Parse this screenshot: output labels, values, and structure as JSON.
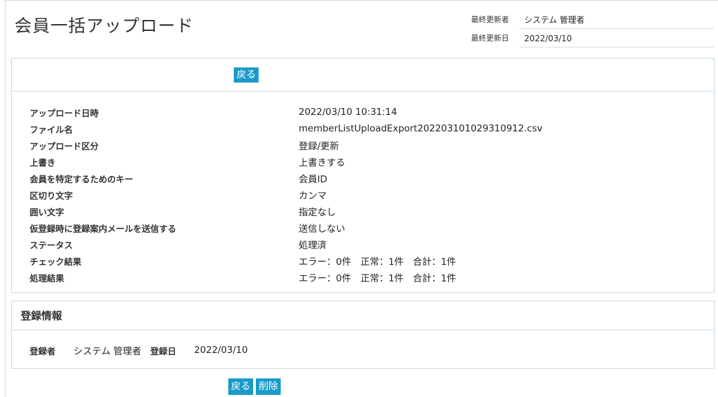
{
  "page": {
    "title": "会員一括アップロード"
  },
  "meta": {
    "last_updated_by_label": "最終更新者",
    "last_updated_by_value": "システム 管理者",
    "last_updated_date_label": "最終更新日",
    "last_updated_date_value": "2022/03/10"
  },
  "toolbar": {
    "back_label": "戻る"
  },
  "details": [
    {
      "label": "アップロード日時",
      "value": "2022/03/10 10:31:14"
    },
    {
      "label": "ファイル名",
      "value": "memberListUploadExport202203101029310912.csv"
    },
    {
      "label": "アップロード区分",
      "value": "登録/更新"
    },
    {
      "label": "上書き",
      "value": "上書きする"
    },
    {
      "label": "会員を特定するためのキー",
      "value": "会員ID"
    },
    {
      "label": "区切り文字",
      "value": "カンマ"
    },
    {
      "label": "囲い文字",
      "value": "指定なし"
    },
    {
      "label": "仮登録時に登録案内メールを送信する",
      "value": "送信しない"
    },
    {
      "label": "ステータス",
      "value": "処理済"
    },
    {
      "label": "チェック結果",
      "value": "エラー：0件　正常：1件　合計：1件"
    },
    {
      "label": "処理結果",
      "value": "エラー：0件　正常：1件　合計：1件"
    }
  ],
  "registration": {
    "heading": "登録情報",
    "registrant_label": "登録者",
    "registrant_value": "システム 管理者",
    "date_label": "登録日",
    "date_value": "2022/03/10"
  },
  "footer": {
    "back_label": "戻る",
    "delete_label": "削除"
  },
  "colors": {
    "button": "#1a9bc8",
    "border": "#c9dbe8"
  }
}
